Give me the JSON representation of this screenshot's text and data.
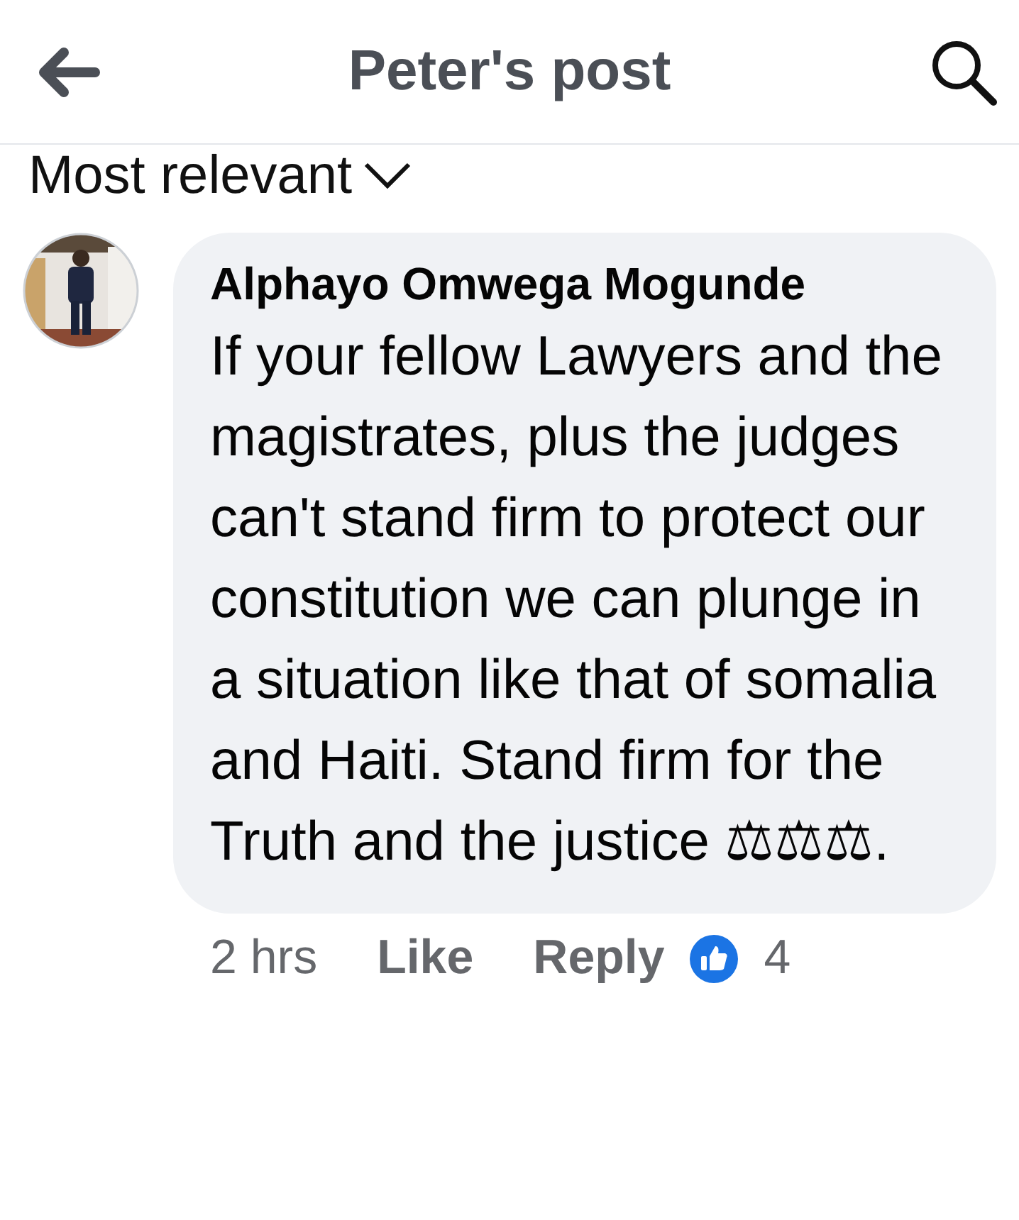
{
  "header": {
    "title": "Peter's post"
  },
  "sort": {
    "label": "Most relevant"
  },
  "comment": {
    "author": "Alphayo Omwega Mogunde",
    "text": "If your fellow Lawyers and the magistrates, plus the judges can't stand firm to protect our constitution we can plunge in a situation like that of somalia and Haiti. Stand firm for the Truth and the justice ⚖⚖⚖.",
    "time": "2 hrs",
    "actions": [
      "Like",
      "Reply"
    ],
    "reaction_count": "4"
  }
}
